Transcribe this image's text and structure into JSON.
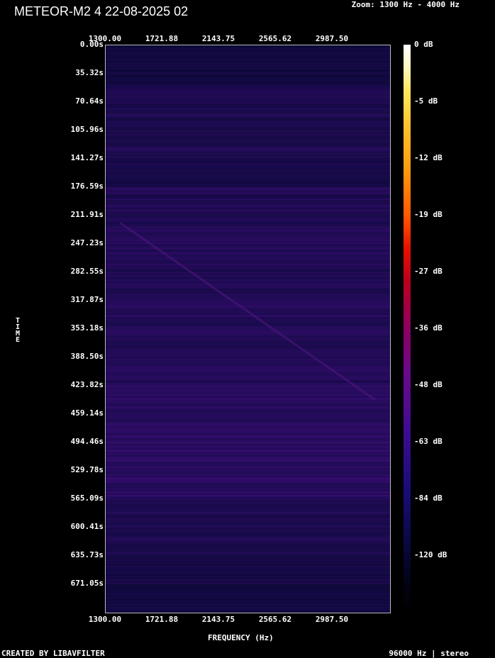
{
  "header": {
    "title": "METEOR-M2 4 22-08-2025 02",
    "zoom_label": "Zoom: 1300 Hz - 4000 Hz"
  },
  "footer": {
    "created_by": "CREATED BY LIBAVFILTER",
    "sample_info": "96000 Hz | stereo"
  },
  "chart_data": {
    "type": "heatmap",
    "title": "METEOR-M2 4 22-08-2025 02",
    "xlabel": "FREQUENCY (Hz)",
    "ylabel": "TIME",
    "xlim": [
      1300,
      4000
    ],
    "ylim": [
      0,
      706.36
    ],
    "x_ticks": [
      "1300.00",
      "1721.88",
      "2143.75",
      "2565.62",
      "2987.50"
    ],
    "y_ticks": [
      "0.00s",
      "35.32s",
      "70.64s",
      "105.96s",
      "141.27s",
      "176.59s",
      "211.91s",
      "247.23s",
      "282.55s",
      "317.87s",
      "353.18s",
      "388.50s",
      "423.82s",
      "459.14s",
      "494.46s",
      "529.78s",
      "565.09s",
      "600.41s",
      "635.73s",
      "671.05s"
    ],
    "colorbar_labels": [
      "0 dB",
      "-5 dB",
      "-12 dB",
      "-19 dB",
      "-27 dB",
      "-36 dB",
      "-48 dB",
      "-63 dB",
      "-84 dB",
      "-120 dB"
    ],
    "colorbar_values_db": [
      0,
      -5,
      -12,
      -19,
      -27,
      -36,
      -48,
      -63,
      -84,
      -120
    ],
    "colormap_colors": [
      "#ffffff",
      "#ffd84a",
      "#ff6a00",
      "#e00000",
      "#7a0a7a",
      "#2a0c88",
      "#0a0a3e",
      "#000000"
    ],
    "background_color": "#0f0b45"
  }
}
